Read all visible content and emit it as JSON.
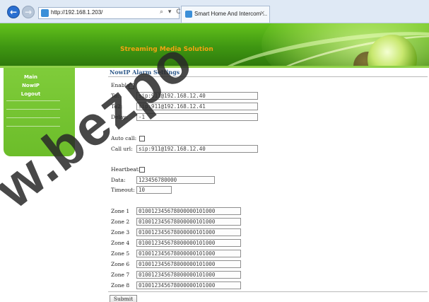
{
  "browser": {
    "url": "http://192.168.1.203/",
    "address_tools": "⌕ ▾ C",
    "tab_title": "Smart Home And Intercom ...",
    "tab_close": "×"
  },
  "header": {
    "title": "Streaming Media Solution",
    "accent_color": "#f3a312",
    "brand_green": "#4ea916"
  },
  "sidebar": {
    "items": [
      {
        "label": "Main"
      },
      {
        "label": "NowIP"
      },
      {
        "label": "Logout"
      }
    ]
  },
  "main": {
    "title": "NowIP Alarm Settings",
    "enable_label": "Enable:",
    "enable_checked": false,
    "to_label": "To:",
    "to_value": "sip:911@192.168.12.40",
    "to2_label": "To2:",
    "to2_value": "sip:911@192.168.12.41",
    "delay_label": "Delay:",
    "delay_value": "-1",
    "autocall_label": "Auto call:",
    "autocall_checked": false,
    "callurl_label": "Call url:",
    "callurl_value": "sip:911@192.168.12.40",
    "heartbeat_label": "Heartbeat:",
    "heartbeat_checked": false,
    "data_label": "Data:",
    "data_value": "123456780000",
    "timeout_label": "Timeout:",
    "timeout_value": "10",
    "zones": [
      {
        "label": "Zone 1",
        "value": "010012345678000000101000"
      },
      {
        "label": "Zone 2",
        "value": "010012345678000000101000"
      },
      {
        "label": "Zone 3",
        "value": "010012345678000000101000"
      },
      {
        "label": "Zone 4",
        "value": "010012345678000000101000"
      },
      {
        "label": "Zone 5",
        "value": "010012345678000000101000"
      },
      {
        "label": "Zone 6",
        "value": "010012345678000000101000"
      },
      {
        "label": "Zone 7",
        "value": "010012345678000000101000"
      },
      {
        "label": "Zone 8",
        "value": "010012345678000000101000"
      }
    ],
    "submit_label": "Submit"
  },
  "watermark": {
    "text": "w.bezpo"
  }
}
